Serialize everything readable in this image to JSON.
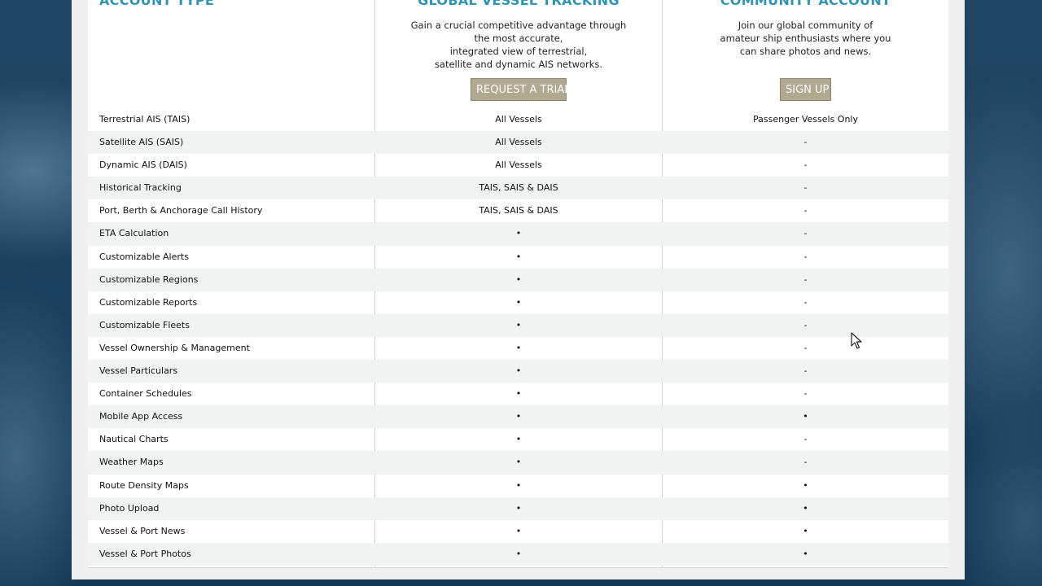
{
  "columns": [
    {
      "title": "ACCOUNT TYPE"
    },
    {
      "title": "GLOBAL VESSEL TRACKING",
      "description": [
        "Gain a crucial competitive advantage through",
        "the most accurate,",
        "integrated view of terrestrial,",
        "satellite and dynamic AIS networks."
      ],
      "button_label": "REQUEST A TRIAL"
    },
    {
      "title": "COMMUNITY ACCOUNT",
      "description": [
        "Join our global community of",
        "amateur ship enthusiasts where you",
        "can share photos and news."
      ],
      "button_label": "SIGN UP"
    }
  ],
  "rows": [
    {
      "feature": "Terrestrial AIS (TAIS)",
      "global": "All Vessels",
      "community": "Passenger Vessels Only"
    },
    {
      "feature": "Satellite AIS (SAIS)",
      "global": "All Vessels",
      "community": "-"
    },
    {
      "feature": "Dynamic AIS (DAIS)",
      "global": "All Vessels",
      "community": "-"
    },
    {
      "feature": "Historical Tracking",
      "global": "TAIS, SAIS & DAIS",
      "community": "-"
    },
    {
      "feature": "Port, Berth & Anchorage Call History",
      "global": "TAIS, SAIS & DAIS",
      "community": "-"
    },
    {
      "feature": "ETA Calculation",
      "global": "•",
      "community": "-"
    },
    {
      "feature": "Customizable Alerts",
      "global": "•",
      "community": "-"
    },
    {
      "feature": "Customizable Regions",
      "global": "•",
      "community": "-"
    },
    {
      "feature": "Customizable Reports",
      "global": "•",
      "community": "-"
    },
    {
      "feature": "Customizable Fleets",
      "global": "•",
      "community": "-"
    },
    {
      "feature": "Vessel Ownership & Management",
      "global": "•",
      "community": "-"
    },
    {
      "feature": "Vessel Particulars",
      "global": "•",
      "community": "-"
    },
    {
      "feature": "Container Schedules",
      "global": "•",
      "community": "-"
    },
    {
      "feature": "Mobile App Access",
      "global": "•",
      "community": "•"
    },
    {
      "feature": "Nautical Charts",
      "global": "•",
      "community": "-"
    },
    {
      "feature": "Weather Maps",
      "global": "•",
      "community": "-"
    },
    {
      "feature": "Route Density Maps",
      "global": "•",
      "community": "•"
    },
    {
      "feature": "Photo Upload",
      "global": "•",
      "community": "•"
    },
    {
      "feature": "Vessel & Port News",
      "global": "•",
      "community": "•"
    },
    {
      "feature": "Vessel & Port Photos",
      "global": "•",
      "community": "•"
    }
  ]
}
